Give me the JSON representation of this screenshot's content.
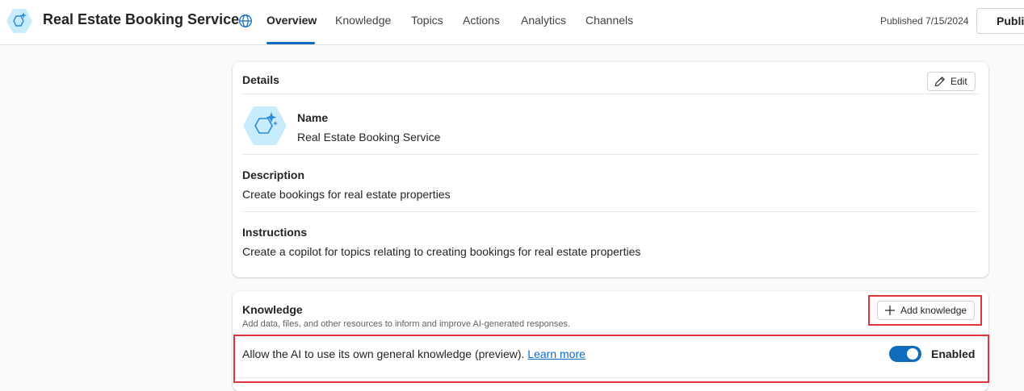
{
  "header": {
    "app_title": "Real Estate Booking Service",
    "tabs": [
      {
        "label": "Overview",
        "active": true
      },
      {
        "label": "Knowledge",
        "active": false
      },
      {
        "label": "Topics",
        "active": false
      },
      {
        "label": "Actions",
        "active": false
      },
      {
        "label": "Analytics",
        "active": false
      },
      {
        "label": "Channels",
        "active": false
      }
    ],
    "published_status": "Published 7/15/2024",
    "publish_button_label": "Publis"
  },
  "details": {
    "title": "Details",
    "edit_label": "Edit",
    "name_label": "Name",
    "name_value": "Real Estate Booking Service",
    "description_label": "Description",
    "description_value": "Create bookings for real estate properties",
    "instructions_label": "Instructions",
    "instructions_value": "Create a copilot for topics relating to creating bookings for real estate properties"
  },
  "knowledge": {
    "title": "Knowledge",
    "subtitle": "Add data, files, and other resources to inform and improve AI-generated responses.",
    "add_button_label": "Add knowledge",
    "general_knowledge_text": "Allow the AI to use its own general knowledge (preview).",
    "learn_more": "Learn more",
    "toggle_state": "Enabled",
    "toggle_on": true
  },
  "colors": {
    "accent": "#0f6cbd",
    "highlight_border": "#e0343a",
    "icon_fill": "#c7ecfb"
  },
  "icons": [
    "copilot-hexagon-icon",
    "globe-icon",
    "pencil-icon",
    "plus-icon"
  ]
}
